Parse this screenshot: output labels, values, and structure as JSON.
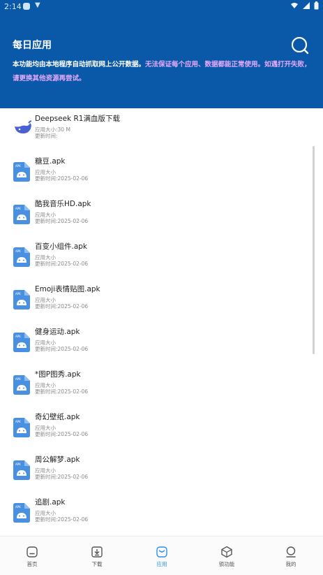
{
  "status_bar": {
    "time": "2:14"
  },
  "header": {
    "title": "每日应用",
    "notice_main": "本功能均由本地程序自动抓取网上公开数据。",
    "notice_warn": "无法保证每个应用、数据都能正常使用。如遇打开失败，请更换其他资源再尝试。"
  },
  "list": {
    "size_label": "应用大小",
    "date_label": "更新时间:",
    "items": [
      {
        "name": "Deepseek R1满血版下载",
        "size": ":30 M",
        "date": "",
        "icon": "whale-logo-icon"
      },
      {
        "name": "糖豆.apk",
        "size": "",
        "date": "2025-02-06",
        "icon": "apk-android-icon"
      },
      {
        "name": "酷我音乐HD.apk",
        "size": "",
        "date": "2025-02-06",
        "icon": "apk-android-icon"
      },
      {
        "name": "百变小组件.apk",
        "size": "",
        "date": "2025-02-06",
        "icon": "apk-android-icon"
      },
      {
        "name": "Emoji表情贴图.apk",
        "size": "",
        "date": "2025-02-06",
        "icon": "apk-android-icon"
      },
      {
        "name": "健身运动.apk",
        "size": "",
        "date": "2025-02-06",
        "icon": "apk-android-icon"
      },
      {
        "name": "*图P图秀.apk",
        "size": "",
        "date": "2025-02-06",
        "icon": "apk-android-icon"
      },
      {
        "name": "奇幻壁纸.apk",
        "size": "",
        "date": "2025-02-06",
        "icon": "apk-android-icon"
      },
      {
        "name": "周公解梦.apk",
        "size": "",
        "date": "2025-02-06",
        "icon": "apk-android-icon"
      },
      {
        "name": "追剧.apk",
        "size": "",
        "date": "2025-02-06",
        "icon": "apk-android-icon"
      }
    ]
  },
  "bottom_nav": {
    "accent_color": "#2d8cf0",
    "items": [
      {
        "label": "首页",
        "icon": "home-icon"
      },
      {
        "label": "下载",
        "icon": "download-icon"
      },
      {
        "label": "应用",
        "icon": "apps-icon",
        "active": true
      },
      {
        "label": "锁功能",
        "icon": "cube-icon"
      },
      {
        "label": "我的",
        "icon": "profile-icon"
      }
    ]
  }
}
